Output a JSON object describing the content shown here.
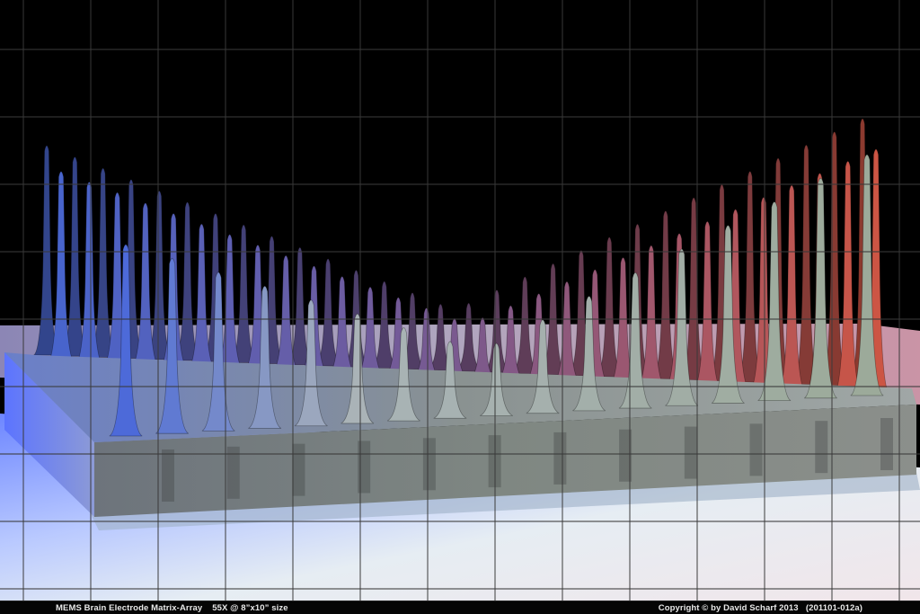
{
  "caption": {
    "left_text": "MEMS Brain Electrode Matrix-Array    55X @ 8”x10” size",
    "right_text": "Copyright © by David Scharf 2013   (201101-012a)"
  },
  "palette": {
    "background": "#000000",
    "grid_line": "#3a3a3a",
    "blue_tint": "#5a7dff",
    "red_tint": "#ff6a55",
    "silver": "#c8d3d8",
    "base_block": "#7e8683",
    "floor_light": "#dfe6ee"
  }
}
